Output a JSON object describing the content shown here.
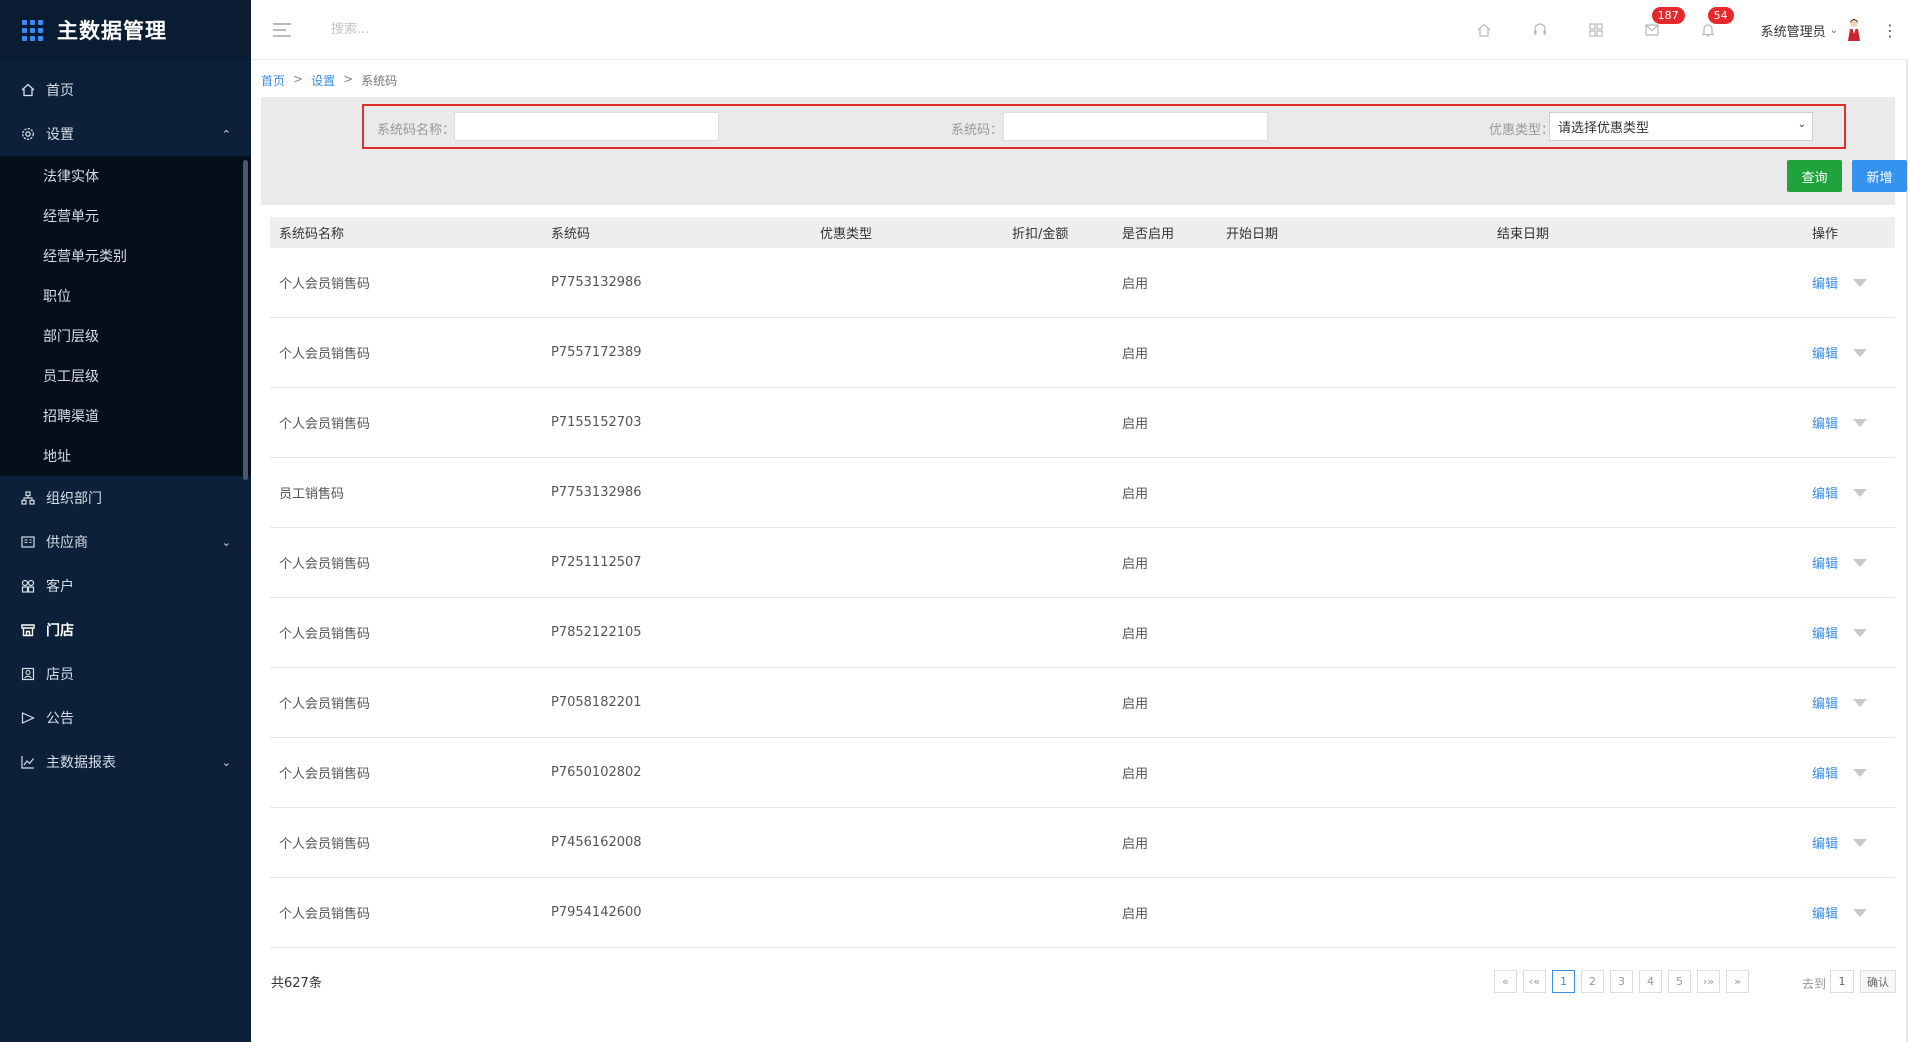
{
  "app": {
    "title": "主数据管理"
  },
  "sidebar": {
    "items": [
      {
        "label": "首页",
        "icon": "home-icon"
      },
      {
        "label": "设置",
        "icon": "gear-icon",
        "expanded": true,
        "children": [
          "法律实体",
          "经营单元",
          "经营单元类别",
          "职位",
          "部门层级",
          "员工层级",
          "招聘渠道",
          "地址"
        ]
      },
      {
        "label": "组织部门",
        "icon": "org-chart-icon"
      },
      {
        "label": "供应商",
        "icon": "supplier-icon",
        "has_arrow": true
      },
      {
        "label": "客户",
        "icon": "customer-icon"
      },
      {
        "label": "门店",
        "icon": "store-icon",
        "active": true
      },
      {
        "label": "店员",
        "icon": "clerk-icon"
      },
      {
        "label": "公告",
        "icon": "announcement-icon"
      },
      {
        "label": "主数据报表",
        "icon": "chart-icon",
        "has_arrow": true
      }
    ]
  },
  "header": {
    "search_placeholder": "搜索...",
    "badges": {
      "messages": "187",
      "notifications": "54"
    },
    "user_name": "系统管理员"
  },
  "breadcrumb": {
    "home": "首页",
    "settings": "设置",
    "current": "系统码",
    "sep": ">"
  },
  "filters": {
    "name_label": "系统码名称：",
    "code_label": "系统码：",
    "type_label": "优惠类型：",
    "type_placeholder": "请选择优惠类型",
    "query_button": "查询",
    "add_button": "新增"
  },
  "table": {
    "columns": [
      "系统码名称",
      "系统码",
      "优惠类型",
      "折扣/金额",
      "是否启用",
      "开始日期",
      "结束日期",
      "操作"
    ],
    "rows": [
      {
        "name": "个人会员销售码",
        "code": "P7753132986",
        "type": "",
        "discount": "",
        "enabled": "启用",
        "start": "",
        "end": "",
        "op": "编辑"
      },
      {
        "name": "个人会员销售码",
        "code": "P7557172389",
        "type": "",
        "discount": "",
        "enabled": "启用",
        "start": "",
        "end": "",
        "op": "编辑"
      },
      {
        "name": "个人会员销售码",
        "code": "P7155152703",
        "type": "",
        "discount": "",
        "enabled": "启用",
        "start": "",
        "end": "",
        "op": "编辑"
      },
      {
        "name": "员工销售码",
        "code": "P7753132986",
        "type": "",
        "discount": "",
        "enabled": "启用",
        "start": "",
        "end": "",
        "op": "编辑"
      },
      {
        "name": "个人会员销售码",
        "code": "P7251112507",
        "type": "",
        "discount": "",
        "enabled": "启用",
        "start": "",
        "end": "",
        "op": "编辑"
      },
      {
        "name": "个人会员销售码",
        "code": "P7852122105",
        "type": "",
        "discount": "",
        "enabled": "启用",
        "start": "",
        "end": "",
        "op": "编辑"
      },
      {
        "name": "个人会员销售码",
        "code": "P7058182201",
        "type": "",
        "discount": "",
        "enabled": "启用",
        "start": "",
        "end": "",
        "op": "编辑"
      },
      {
        "name": "个人会员销售码",
        "code": "P7650102802",
        "type": "",
        "discount": "",
        "enabled": "启用",
        "start": "",
        "end": "",
        "op": "编辑"
      },
      {
        "name": "个人会员销售码",
        "code": "P7456162008",
        "type": "",
        "discount": "",
        "enabled": "启用",
        "start": "",
        "end": "",
        "op": "编辑"
      },
      {
        "name": "个人会员销售码",
        "code": "P7954142600",
        "type": "",
        "discount": "",
        "enabled": "启用",
        "start": "",
        "end": "",
        "op": "编辑"
      }
    ]
  },
  "footer": {
    "total": "共627条",
    "pages": [
      "«",
      "‹«",
      "1",
      "2",
      "3",
      "4",
      "5",
      "›»",
      "»"
    ],
    "current_page": "1",
    "goto_label": "去到",
    "goto_value": "1",
    "confirm": "确认"
  },
  "colors": {
    "sidebar_bg": "#0c2139",
    "primary": "#3a8ee6",
    "success": "#1fa33d",
    "danger": "#e5292c"
  }
}
